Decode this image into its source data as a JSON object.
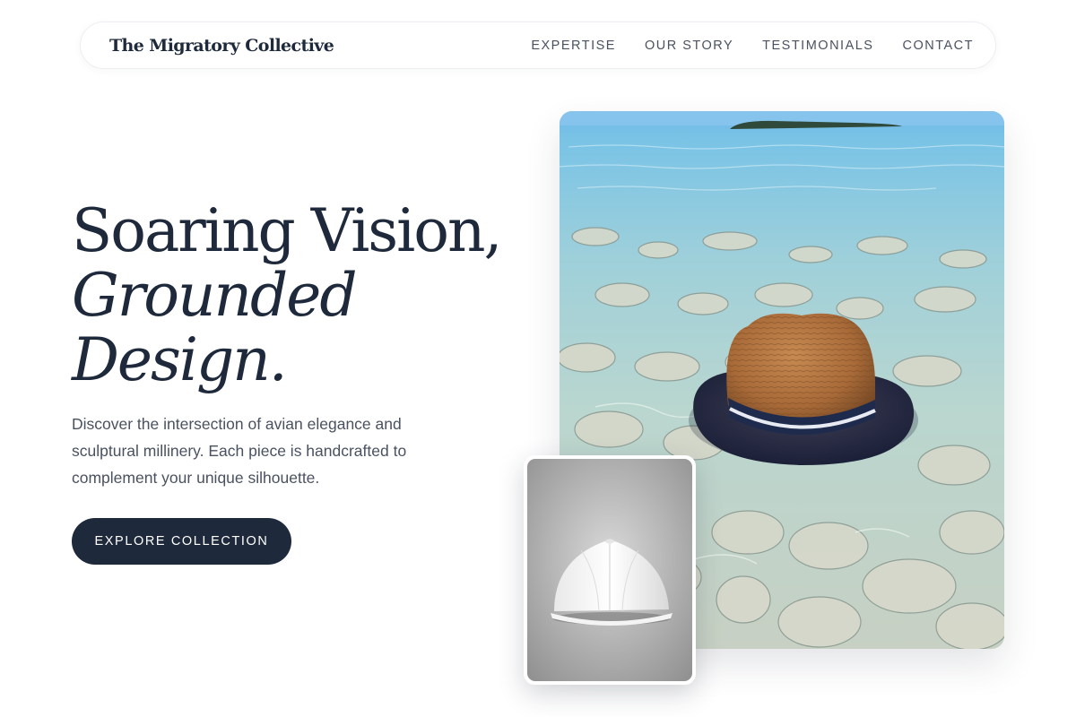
{
  "nav": {
    "brand": "The Migratory Collective",
    "links": [
      "EXPERTISE",
      "OUR STORY",
      "TESTIMONIALS",
      "CONTACT"
    ]
  },
  "hero": {
    "title_line1": "Soaring Vision,",
    "title_line2": "Grounded",
    "title_line3": "Design.",
    "description": "Discover the intersection of avian elegance and sculptural millinery. Each piece is handcrafted to complement your unique silhouette.",
    "cta_label": "EXPLORE COLLECTION"
  },
  "images": {
    "main": "straw-hat-on-water-photo",
    "thumb": "white-cap-photo"
  },
  "colors": {
    "primary": "#1e2a3c",
    "text_muted": "#4a5160",
    "border": "#eceef2"
  }
}
